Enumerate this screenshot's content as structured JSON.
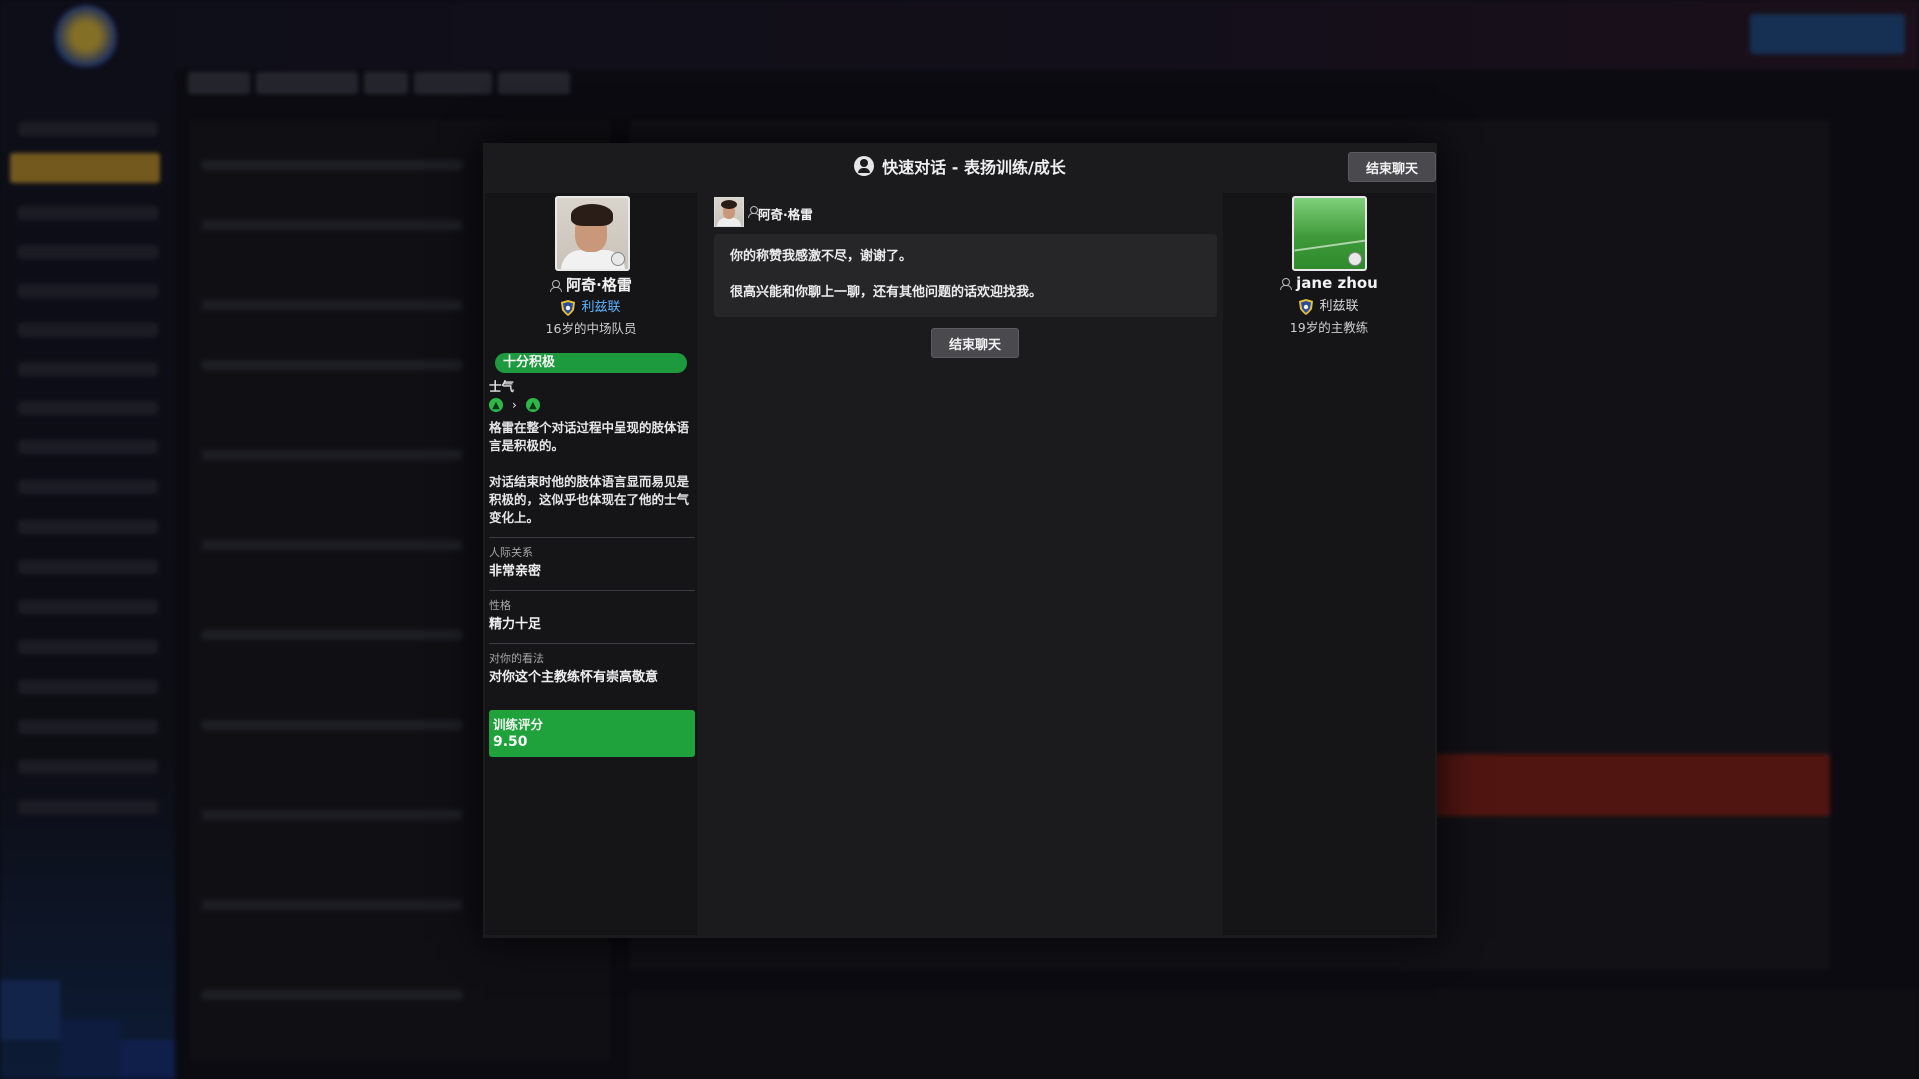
{
  "dialog": {
    "title": "快速对话 - 表扬训练/成长",
    "end_chat_label": "结束聊天"
  },
  "player": {
    "name": "阿奇·格雷",
    "club": "利兹联",
    "description": "16岁的中场队员",
    "mood": "十分积极",
    "morale_label": "士气",
    "body_language_1": "格雷在整个对话过程中呈现的肢体语言是积极的。",
    "body_language_2": "对话结束时他的肢体语言显而易见是积极的，这似乎也体现在了他的士气变化上。",
    "relationship_label": "人际关系",
    "relationship_value": "非常亲密",
    "personality_label": "性格",
    "personality_value": "精力十足",
    "opinion_label": "对你的看法",
    "opinion_value": "对你这个主教练怀有崇高敬意",
    "rating_label": "训练评分",
    "rating_value": "9.50"
  },
  "conversation": {
    "speaker": "阿奇·格雷",
    "line_1": "你的称赞我感激不尽，谢谢了。",
    "line_2": "很高兴能和你聊上一聊，还有其他问题的话欢迎找我。",
    "end_chat_label": "结束聊天"
  },
  "manager": {
    "name": "jane zhou",
    "club": "利兹联",
    "description": "19岁的主教练"
  },
  "colors": {
    "club_link": "#5ab4ff",
    "positive_green": "#1fa13c",
    "modal_bg": "#1b1b1e"
  }
}
